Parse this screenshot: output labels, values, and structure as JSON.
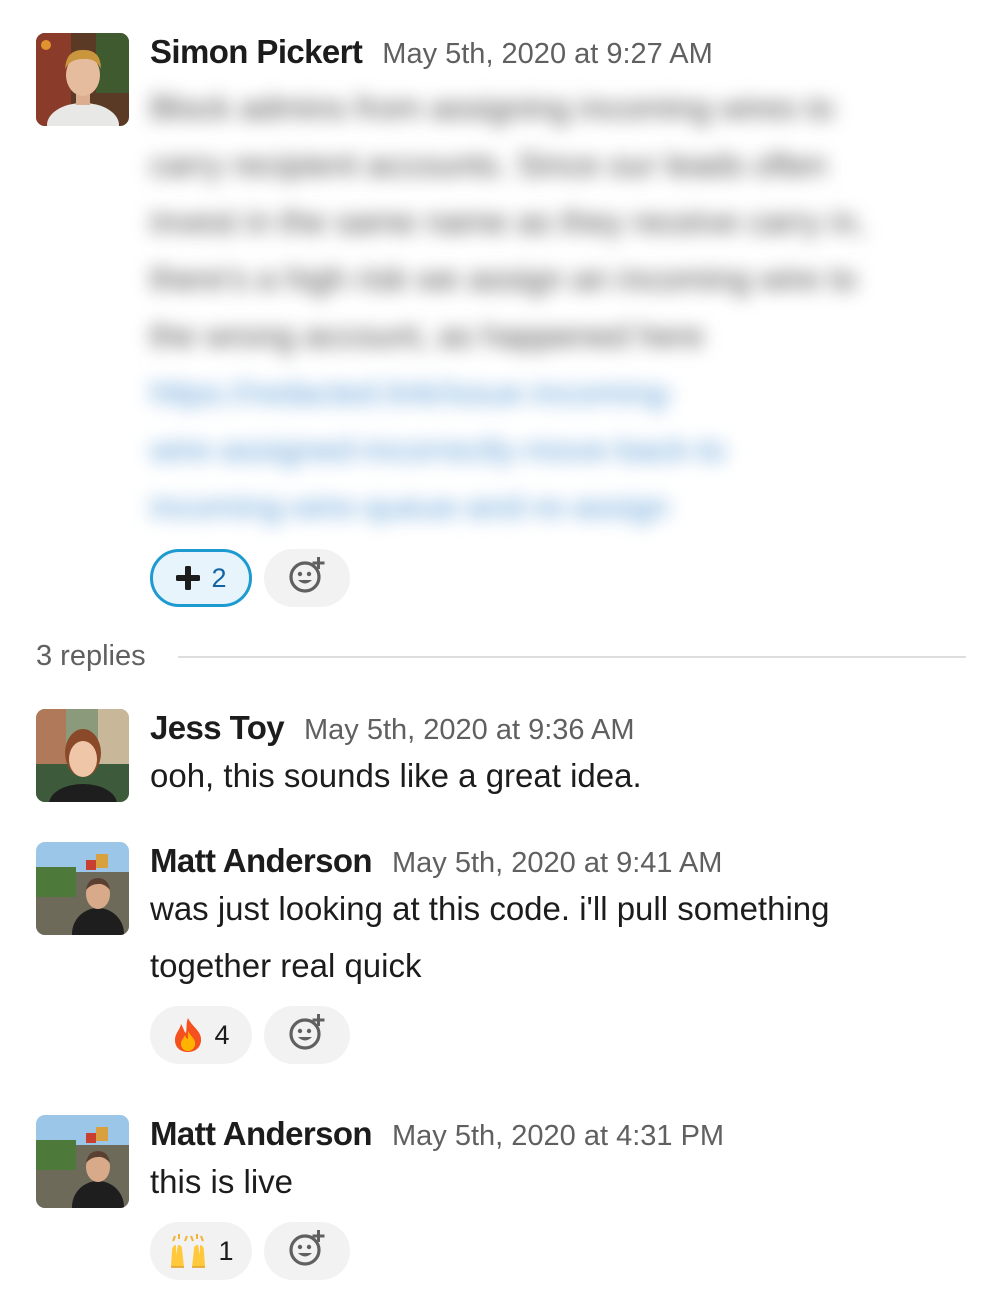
{
  "thread": {
    "replies_label": "3 replies"
  },
  "messages": [
    {
      "author": "Simon Pickert",
      "time": "May 5th, 2020 at 9:27 AM",
      "reactions": [
        {
          "icon": "heavy-plus-icon",
          "count": "2",
          "active": true
        }
      ]
    },
    {
      "author": "Jess Toy",
      "time": "May 5th, 2020 at 9:36 AM",
      "text": "ooh, this sounds like a great idea."
    },
    {
      "author": "Matt Anderson",
      "time": "May 5th, 2020 at 9:41 AM",
      "text_line1": "was just looking at this code. i'll pull something",
      "text_line2": "together real quick",
      "reactions": [
        {
          "icon": "fire-icon",
          "count": "4"
        }
      ]
    },
    {
      "author": "Matt Anderson",
      "time": "May 5th, 2020 at 4:31 PM",
      "text": "this is live",
      "reactions": [
        {
          "icon": "raised-hands-icon",
          "count": "1"
        }
      ]
    }
  ],
  "colors": {
    "active_reaction_border": "#1d9bd1",
    "active_reaction_text": "#1264a3",
    "timestamp": "#616061"
  }
}
